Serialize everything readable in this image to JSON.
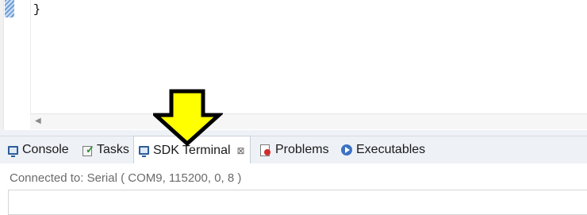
{
  "editor": {
    "code_line": "}"
  },
  "tabs": [
    {
      "label": "Console",
      "icon": "console-icon",
      "active": false
    },
    {
      "label": "Tasks",
      "icon": "tasks-icon",
      "active": false
    },
    {
      "label": "SDK Terminal",
      "icon": "terminal-icon",
      "active": true,
      "close": "⊠"
    },
    {
      "label": "Problems",
      "icon": "problems-icon",
      "active": false
    },
    {
      "label": "Executables",
      "icon": "executables-icon",
      "active": false
    }
  ],
  "terminal": {
    "status": "Connected to: Serial (  COM9, 115200, 0, 8 )"
  },
  "colors": {
    "arrow_fill": "#ffff00",
    "arrow_stroke": "#000000",
    "tab_bar": "#eef1f6"
  }
}
